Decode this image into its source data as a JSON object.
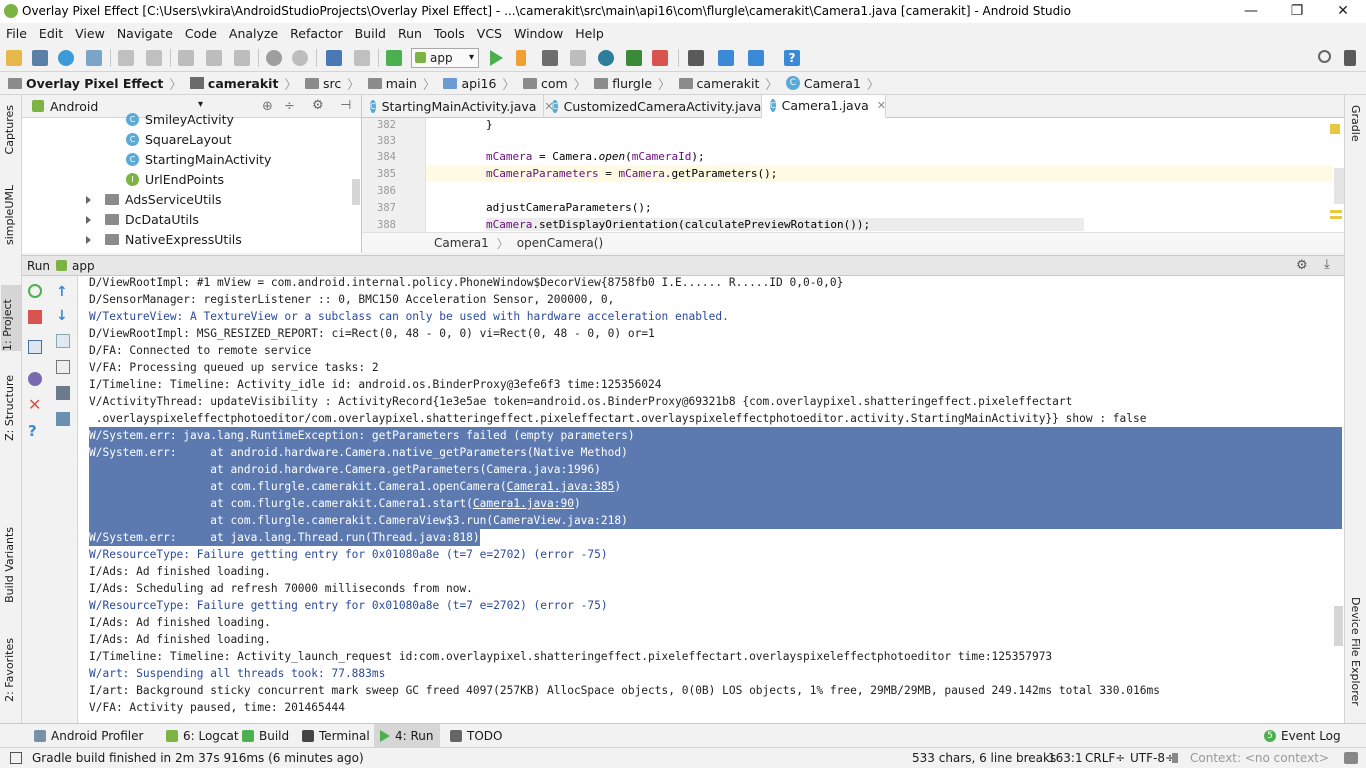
{
  "window": {
    "title": "Overlay Pixel Effect [C:\\Users\\vkira\\AndroidStudioProjects\\Overlay Pixel Effect] - ...\\camerakit\\src\\main\\api16\\com\\flurgle\\camerakit\\Camera1.java [camerakit] - Android Studio",
    "minimize": "—",
    "maximize": "❐",
    "close": "✕"
  },
  "menu": [
    "File",
    "Edit",
    "View",
    "Navigate",
    "Code",
    "Analyze",
    "Refactor",
    "Build",
    "Run",
    "Tools",
    "VCS",
    "Window",
    "Help"
  ],
  "toolbar": {
    "run_config": "app"
  },
  "breadcrumb": [
    "Overlay Pixel Effect",
    "camerakit",
    "src",
    "main",
    "api16",
    "com",
    "flurgle",
    "camerakit",
    "Camera1"
  ],
  "left_strip": {
    "captures": "Captures",
    "simpleuml": "simpleUML",
    "project": "1: Project",
    "structure": "Z: Structure",
    "build_variants": "Build Variants",
    "favorites": "2: Favorites"
  },
  "right_strip": {
    "gradle": "Gradle",
    "device_explorer": "Device File Explorer"
  },
  "project_panel": {
    "view_mode": "Android",
    "items": [
      {
        "label": "SmileyActivity",
        "kind": "class"
      },
      {
        "label": "SquareLayout",
        "kind": "class"
      },
      {
        "label": "StartingMainActivity",
        "kind": "class"
      },
      {
        "label": "UrlEndPoints",
        "kind": "interface"
      },
      {
        "label": "AdsServiceUtils",
        "kind": "folder"
      },
      {
        "label": "DcDataUtils",
        "kind": "folder"
      },
      {
        "label": "NativeExpressUtils",
        "kind": "folder"
      }
    ]
  },
  "editor": {
    "tabs": [
      {
        "label": "StartingMainActivity.java"
      },
      {
        "label": "CustomizedCameraActivity.java"
      },
      {
        "label": "Camera1.java"
      }
    ],
    "lines": [
      {
        "num": "382",
        "text": "}"
      },
      {
        "num": "383",
        "text": ""
      },
      {
        "num": "384",
        "field": "mCamera",
        "rest_a": " = Camera.",
        "ital": "open",
        "rest_b": "(",
        "field2": "mCameraId",
        "rest_c": ");"
      },
      {
        "num": "385",
        "field": "mCameraParameters",
        "rest_a": " = ",
        "field2": "mCamera",
        "rest_c": ".getParameters();"
      },
      {
        "num": "386",
        "text": ""
      },
      {
        "num": "387",
        "text": "adjustCameraParameters();"
      },
      {
        "num": "388",
        "field": "mCamera",
        "rest_c": ".setDisplayOrientation(calculatePreviewRotation());"
      }
    ],
    "breadcrumb_class": "Camera1",
    "breadcrumb_method": "openCamera()"
  },
  "run": {
    "label": "Run",
    "config": "app",
    "console": [
      {
        "t": "D/ViewRootImpl: #1 mView = com.android.internal.policy.PhoneWindow$DecorView{8758fb0 I.E...... R.....ID 0,0-0,0}",
        "c": "d"
      },
      {
        "t": "D/SensorManager: registerListener :: 0, BMC150 Acceleration Sensor, 200000, 0,",
        "c": "d"
      },
      {
        "t": "W/TextureView: A TextureView or a subclass can only be used with hardware acceleration enabled.",
        "c": "w"
      },
      {
        "t": "D/ViewRootImpl: MSG_RESIZED_REPORT: ci=Rect(0, 48 - 0, 0) vi=Rect(0, 48 - 0, 0) or=1",
        "c": "d"
      },
      {
        "t": "D/FA: Connected to remote service",
        "c": "d"
      },
      {
        "t": "V/FA: Processing queued up service tasks: 2",
        "c": "d"
      },
      {
        "t": "I/Timeline: Timeline: Activity_idle id: android.os.BinderProxy@3efe6f3 time:125356024",
        "c": "d"
      },
      {
        "t": "V/ActivityThread: updateVisibility : ActivityRecord{1e3e5ae token=android.os.BinderProxy@69321b8 {com.overlaypixel.shatteringeffect.pixeleffectart",
        "c": "d"
      },
      {
        "t": " .overlayspixeleffectphotoeditor/com.overlaypixel.shatteringeffect.pixeleffectart.overlayspixeleffectphotoeditor.activity.StartingMainActivity}} show : false",
        "c": "d"
      },
      {
        "t": "W/System.err: java.lang.RuntimeException: getParameters failed (empty parameters)",
        "c": "s"
      },
      {
        "t": "W/System.err:     at android.hardware.Camera.native_getParameters(Native Method)",
        "c": "s"
      },
      {
        "t": "                  at android.hardware.Camera.getParameters(Camera.java:1996)",
        "c": "s"
      },
      {
        "t": "                  at com.flurgle.camerakit.Camera1.openCamera(",
        "link": "Camera1.java:385",
        "after": ")",
        "c": "s"
      },
      {
        "t": "                  at com.flurgle.camerakit.Camera1.start(",
        "link": "Camera1.java:90",
        "after": ")",
        "c": "s"
      },
      {
        "t": "                  at com.flurgle.camerakit.CameraView$3.run(CameraView.java:218)",
        "c": "s"
      },
      {
        "t": "W/System.err:     at java.lang.Thread.run(Thread.java:818)",
        "c": "sp"
      },
      {
        "t": "W/ResourceType: Failure getting entry for 0x01080a8e (t=7 e=2702) (error -75)",
        "c": "w"
      },
      {
        "t": "I/Ads: Ad finished loading.",
        "c": "d"
      },
      {
        "t": "I/Ads: Scheduling ad refresh 70000 milliseconds from now.",
        "c": "d"
      },
      {
        "t": "W/ResourceType: Failure getting entry for 0x01080a8e (t=7 e=2702) (error -75)",
        "c": "w"
      },
      {
        "t": "I/Ads: Ad finished loading.",
        "c": "d"
      },
      {
        "t": "I/Ads: Ad finished loading.",
        "c": "d"
      },
      {
        "t": "I/Timeline: Timeline: Activity_launch_request id:com.overlaypixel.shatteringeffect.pixeleffectart.overlayspixeleffectphotoeditor time:125357973",
        "c": "d"
      },
      {
        "t": "W/art: Suspending all threads took: 77.883ms",
        "c": "w"
      },
      {
        "t": "I/art: Background sticky concurrent mark sweep GC freed 4097(257KB) AllocSpace objects, 0(0B) LOS objects, 1% free, 29MB/29MB, paused 249.142ms total 330.016ms",
        "c": "d"
      },
      {
        "t": "V/FA: Activity paused, time: 201465444",
        "c": "d"
      }
    ]
  },
  "bottom_tabs": {
    "profiler": "Android Profiler",
    "logcat": "6: Logcat",
    "build": "Build",
    "terminal": "Terminal",
    "run": "4: Run",
    "todo": "TODO",
    "event_log": "Event Log",
    "event_count": "5"
  },
  "status": {
    "message": "Gradle build finished in 2m 37s 916ms (6 minutes ago)",
    "chars": "533 chars, 6 line breaks",
    "position": "163:1",
    "line_sep": "CRLF÷",
    "encoding": "UTF-8÷",
    "context": "Context: <no context>"
  },
  "colors": {
    "selection": "#5c7ab0",
    "warning_text": "#2a4a9a",
    "field": "#660e7a",
    "run_green": "#4caf50",
    "stop_red": "#d9534f"
  }
}
